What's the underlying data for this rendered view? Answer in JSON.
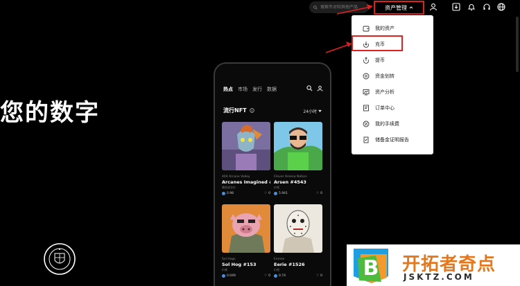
{
  "topbar": {
    "search_placeholder": "搜索币对和其他产品",
    "asset_menu_label": "资产管理",
    "icons": [
      "user-icon",
      "download-icon",
      "bell-icon",
      "headset-icon",
      "globe-icon"
    ]
  },
  "hero": {
    "title": "您的数字"
  },
  "phone": {
    "nav": [
      "热点",
      "市场",
      "发行",
      "数据"
    ],
    "section_title": "流行NFT",
    "time_filter": "24小时",
    "cards": [
      {
        "collection": "404 Arcane Valley",
        "name": "Arcanes Imagined #...",
        "sub": "最低成交价",
        "price": "0.98",
        "likes": "0"
      },
      {
        "collection": "Clever Arsena Nation",
        "name": "Arsen #4543",
        "sub": "价格",
        "price": "5.941",
        "likes": "0"
      },
      {
        "collection": "Sol Hogs",
        "name": "Sol Hog #153",
        "sub": "价格",
        "price": "0.049",
        "likes": "0"
      },
      {
        "collection": "Eernes",
        "name": "Eerie #1526",
        "sub": "价格",
        "price": "0.74",
        "likes": "0"
      }
    ]
  },
  "dropdown": {
    "items": [
      {
        "label": "我的资产",
        "icon": "wallet-icon"
      },
      {
        "label": "充币",
        "icon": "deposit-icon"
      },
      {
        "label": "提币",
        "icon": "withdraw-icon"
      },
      {
        "label": "资金划转",
        "icon": "transfer-icon"
      },
      {
        "label": "资产分析",
        "icon": "analytics-icon"
      },
      {
        "label": "订单中心",
        "icon": "orders-icon"
      },
      {
        "label": "我的手续费",
        "icon": "fee-icon"
      },
      {
        "label": "储备金证明报告",
        "icon": "reserve-report-icon"
      }
    ]
  },
  "watermark": {
    "title": "开拓者奇点",
    "url": "JSKTZ.COM",
    "logo_letter": "B"
  },
  "colors": {
    "highlight": "#e02020",
    "accent_orange": "#e3781e",
    "nft_blue": "#4a90e2"
  }
}
